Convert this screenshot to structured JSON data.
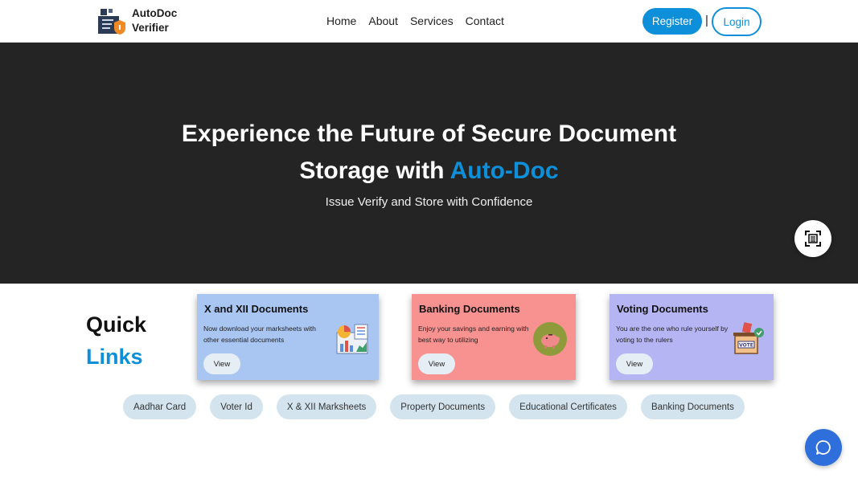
{
  "brand": {
    "line1": "AutoDoc",
    "line2": "Verifier",
    "logo_icon": "document-shield-icon"
  },
  "nav": {
    "items": [
      "Home",
      "About",
      "Services",
      "Contact"
    ],
    "register_label": "Register",
    "separator": "|",
    "login_label": "Login"
  },
  "hero": {
    "title_part1": "Experience the Future of Secure Document",
    "title_part2": "Storage with",
    "title_accent": "Auto-Doc",
    "subtitle": "Issue Verify and Store with Confidence",
    "scan_icon": "scan-document-icon"
  },
  "quick_links": {
    "title_line1": "Quick",
    "title_line2": "Links",
    "cards": [
      {
        "title": "X and XII Documents",
        "desc": "Now download your marksheets with other essential documents",
        "button": "View",
        "icon": "chart-report-icon"
      },
      {
        "title": "Banking Documents",
        "desc": "Enjoy your savings and earning with best way to utilizing",
        "button": "View",
        "icon": "piggy-bank-icon"
      },
      {
        "title": "Voting Documents",
        "desc": "You are the one who rule yourself by voting to the rulers",
        "button": "View",
        "icon": "ballot-box-icon"
      }
    ],
    "chips": [
      "Aadhar Card",
      "Voter Id",
      "X & XII Marksheets",
      "Property Documents",
      "Educational Certificates",
      "Banking Documents"
    ]
  },
  "chat": {
    "icon": "chat-bubble-icon"
  },
  "colors": {
    "accent": "#0d8fd9",
    "hero_bg": "#242424",
    "card1": "#a9c6f3",
    "card2": "#f89290",
    "card3": "#b6b5f4",
    "chip_bg": "#d3e4ef",
    "chat_fab": "#2f6fdb"
  }
}
